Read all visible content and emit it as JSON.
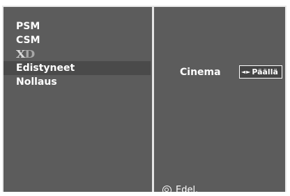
{
  "menu": {
    "items": [
      {
        "label": "PSM"
      },
      {
        "label": "CSM"
      },
      {
        "label": "XD",
        "logo_parts": [
          "X",
          "D"
        ]
      },
      {
        "label": "Edistyneet",
        "selected": true
      },
      {
        "label": "Nollaus"
      }
    ]
  },
  "option": {
    "label": "Cinema",
    "left_arrow": "◄",
    "right_arrow": "►",
    "value": "Päällä"
  },
  "footer": {
    "back_label": "Edel.",
    "icon": "circle-back-icon"
  },
  "colors": {
    "panel_bg": "#5c5c5c",
    "selected_bg": "#4a4a4a",
    "text": "#ffffff",
    "divider": "#e6e6e6"
  }
}
